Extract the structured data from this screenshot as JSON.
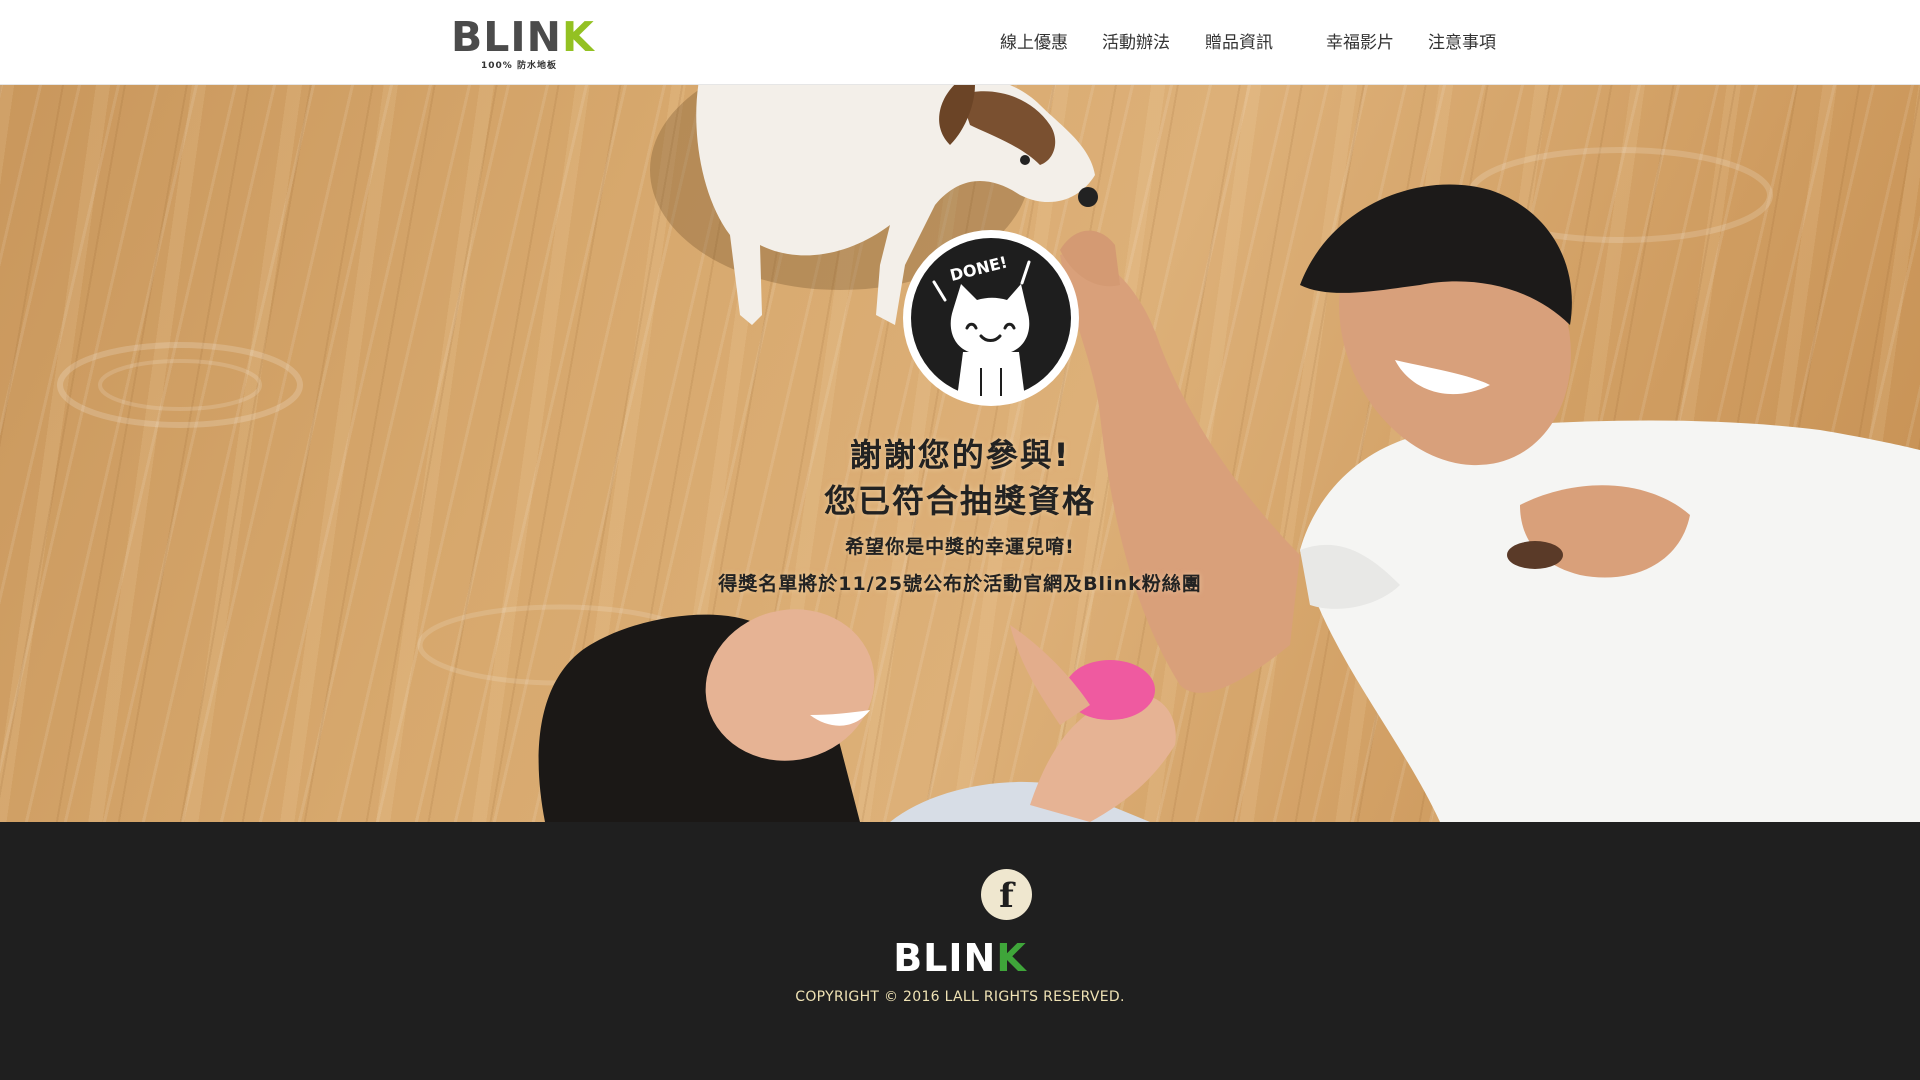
{
  "header": {
    "logo": {
      "word_main": "BLIN",
      "word_accent": "K",
      "tagline": "100% 防水地板"
    },
    "nav": [
      {
        "label": "線上優惠"
      },
      {
        "label": "活動辦法"
      },
      {
        "label": "贈品資訊"
      },
      {
        "label": "幸福影片"
      },
      {
        "label": "注意事項"
      }
    ]
  },
  "hero": {
    "badge_text": "DONE!",
    "title_line1": "謝謝您的參與!",
    "title_line2": "您已符合抽獎資格",
    "line1": "希望你是中獎的幸運兒唷!",
    "line2": "得獎名單將於11/25號公布於活動官網及Blink粉絲團"
  },
  "footer": {
    "facebook_icon": "facebook-icon",
    "facebook_glyph": "f",
    "logo_main": "BLIN",
    "logo_accent": "K",
    "copyright": "COPYRIGHT © 2016 LALL RIGHTS RESERVED."
  },
  "colors": {
    "logo_accent": "#93c122",
    "footer_logo_accent": "#3fa53a",
    "footer_bg": "#1f1f1f",
    "copyright": "#efe2b4"
  }
}
